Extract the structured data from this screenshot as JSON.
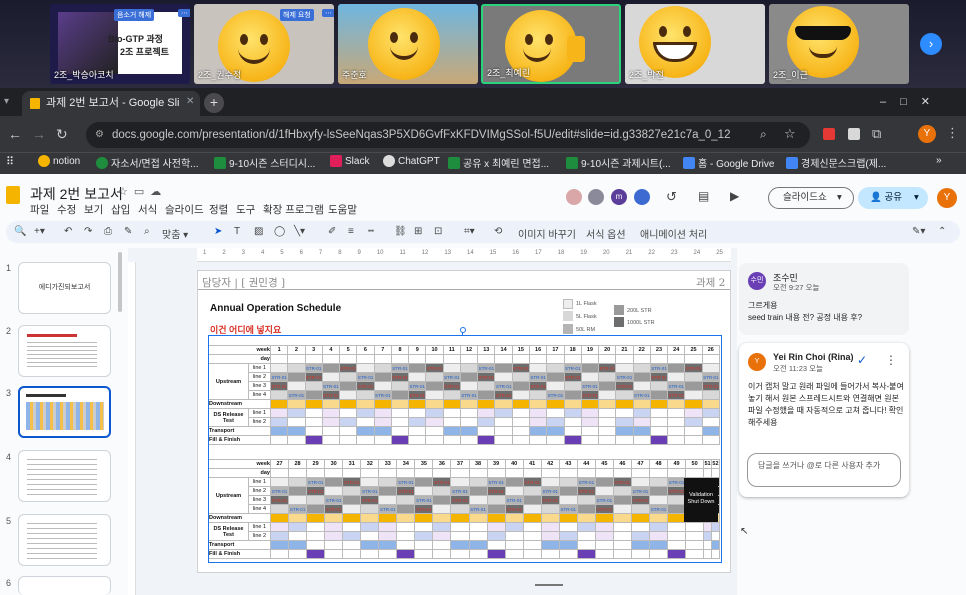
{
  "meeting": {
    "tiles": [
      {
        "name": "2조_박승아코치",
        "badge": "음소거 해제"
      },
      {
        "name": "2조_권수정",
        "badge": "해제 요청"
      },
      {
        "name": "주준호"
      },
      {
        "name": "2조_최예린"
      },
      {
        "name": "2조_박전"
      },
      {
        "name": "2조_이근"
      }
    ],
    "slide_preview": {
      "line1": "Bio-GTP 과정",
      "line2": "2조 프로젝트"
    }
  },
  "browser": {
    "tab_title": "과제 2번 보고서 - Google Sli",
    "url": "docs.google.com/presentation/d/1fHbxyfy-lsSeeNqas3P5XD6GvfFxKFDVIMgSSol-f5U/edit#slide=id.g33827e21c7a_0_12",
    "bookmarks": [
      "notion",
      "자소서/면접 사전학...",
      "9-10시즌 스터디시...",
      "Slack",
      "ChatGPT",
      "공유 x 최예린 면접...",
      "9-10시즌 과제시트(...",
      "홈 - Google Drive",
      "경제신문스크랩(제..."
    ],
    "profile": "Y"
  },
  "docs": {
    "title": "과제 2번 보고서",
    "menus": [
      "파일",
      "수정",
      "보기",
      "삽입",
      "서식",
      "슬라이드",
      "정렬",
      "도구",
      "확장 프로그램",
      "도움말"
    ],
    "slideshow_button": "슬라이드쇼",
    "share_button": "공유",
    "toolbar": {
      "fit": "맞춤",
      "replace_image": "이미지 바꾸기",
      "format_options": "서식 옵션",
      "animation": "애니메이션 처리"
    },
    "ruler_ticks": [
      "1",
      "2",
      "3",
      "4",
      "5",
      "6",
      "7",
      "8",
      "9",
      "10",
      "11",
      "12",
      "13",
      "14",
      "15",
      "16",
      "17",
      "18",
      "19",
      "20",
      "21",
      "22",
      "23",
      "24",
      "25"
    ],
    "thumbs": [
      {
        "num": "1",
        "text": "에디가진되보고서"
      },
      {
        "num": "2"
      },
      {
        "num": "3"
      },
      {
        "num": "4"
      },
      {
        "num": "5"
      },
      {
        "num": "6"
      }
    ]
  },
  "slide": {
    "owner_label": "담당자 | [ 권민경 ]",
    "assignment": "과제 2",
    "title": "Annual Operation Schedule",
    "subtitle": "이건 어디에 넣지요",
    "legend": [
      "1L Flask",
      "5L Flask",
      "50L RM",
      "200L STR",
      "1000L STR"
    ],
    "row_labels": [
      "week",
      "day",
      "Upstream",
      "line 1",
      "line 2",
      "line 3",
      "line 4",
      "Downstream",
      "DS Release Test",
      "line 1",
      "line 2",
      "Transport",
      "Fill & Finish"
    ],
    "weeks_top": [
      "1",
      "2",
      "3",
      "4",
      "5",
      "6",
      "7",
      "8",
      "9",
      "10",
      "11",
      "12",
      "13",
      "14",
      "15",
      "16",
      "17",
      "18",
      "19",
      "20",
      "21",
      "22",
      "23",
      "24",
      "25",
      "26"
    ],
    "weeks_bottom": [
      "27",
      "28",
      "29",
      "30",
      "31",
      "32",
      "33",
      "34",
      "35",
      "36",
      "37",
      "38",
      "39",
      "40",
      "41",
      "42",
      "43",
      "44",
      "45",
      "46",
      "47",
      "48",
      "49",
      "50",
      "51",
      "52"
    ],
    "str_label": "STR-01",
    "shutdown": "Validation Shut Down"
  },
  "comments": [
    {
      "author": "조수민",
      "avatar": "수민",
      "time": "오전 9:27 오늘",
      "text": "그르게용\nseed train 내용 전? 공정 내용 후?"
    },
    {
      "author": "Yei Rin Choi (Rina)",
      "avatar": "Y",
      "time": "오전 11:23 오늘",
      "text": "이거 캡처 말고 원래 파일에 들어가서 복사-붙여 놓기 해서 원본 스프레드시트와 연결해면 원본파일 수정했을 때 자동적으로 고쳐 줍니다! 확인해주세용",
      "reply_placeholder": "답글을 쓰거나 @로 다른 사용자 추가"
    }
  ],
  "colors": {
    "docs_blue": "#0b57d0",
    "yellow": "#f4b400",
    "schedule_red": "#d93025",
    "purple": "#6a3fb5"
  }
}
